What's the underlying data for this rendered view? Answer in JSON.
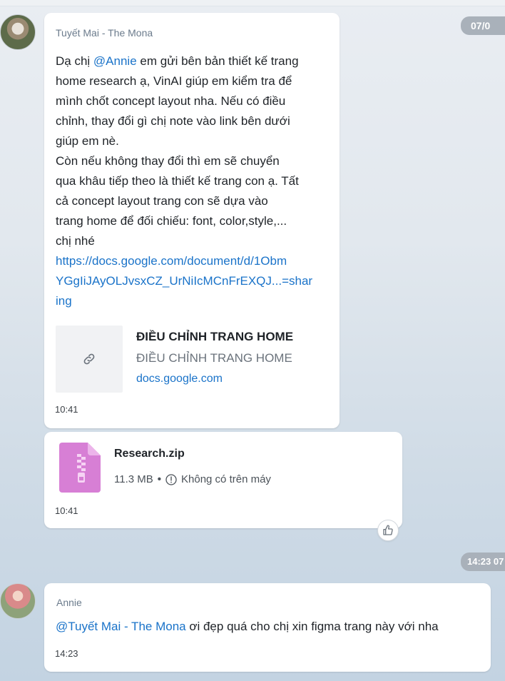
{
  "dates": {
    "top": "07/0",
    "mid": "14:23 07"
  },
  "messages": [
    {
      "sender": "Tuyết Mai - The Mona",
      "lines": [
        {
          "prefix": "Dạ chị ",
          "mention": "@Annie",
          "suffix": " em gửi bên bản thiết kế trang"
        },
        {
          "text": "home research ạ, VinAI giúp em kiểm tra để"
        },
        {
          "text": "mình chốt concept layout nha. Nếu có điều"
        },
        {
          "text": "chỉnh, thay đổi gì chị note vào link bên dưới"
        },
        {
          "text": "giúp em nè."
        },
        {
          "text": "Còn nếu không thay đổi thì em sẽ chuyển"
        },
        {
          "text": "qua khâu tiếp theo là thiết kế trang con ạ. Tất"
        },
        {
          "text": "cả concept layout trang con sẽ dựa vào"
        },
        {
          "text": "trang home để đối chiếu: font, color,style,..."
        },
        {
          "text": "chị nhé"
        }
      ],
      "link_lines": [
        "https://docs.google.com/document/d/1Obm",
        "YGgIiJAyOLJvsxCZ_UrNiIcMCnFrEXQJ...=shar",
        "ing"
      ],
      "preview": {
        "icon": "link-icon",
        "title": "ĐIỀU CHỈNH TRANG HOME",
        "description": "ĐIỀU CHỈNH TRANG HOME",
        "domain": "docs.google.com"
      },
      "time": "10:41"
    },
    {
      "file": {
        "icon": "zip-file-icon",
        "name": "Research.zip",
        "size": "11.3 MB",
        "status_icon": "info-icon",
        "status": "Không có trên máy"
      },
      "time": "10:41",
      "reaction_icon": "thumbs-up-icon"
    },
    {
      "sender": "Annie",
      "mention": "@Tuyết Mai - The Mona",
      "text": " ơi đẹp quá cho chị xin figma trang này với nha",
      "time": "14:23"
    }
  ],
  "colors": {
    "accent": "#1a73c9",
    "zip_file": "#d77fd5",
    "date_pill": "#a9b1ba"
  }
}
